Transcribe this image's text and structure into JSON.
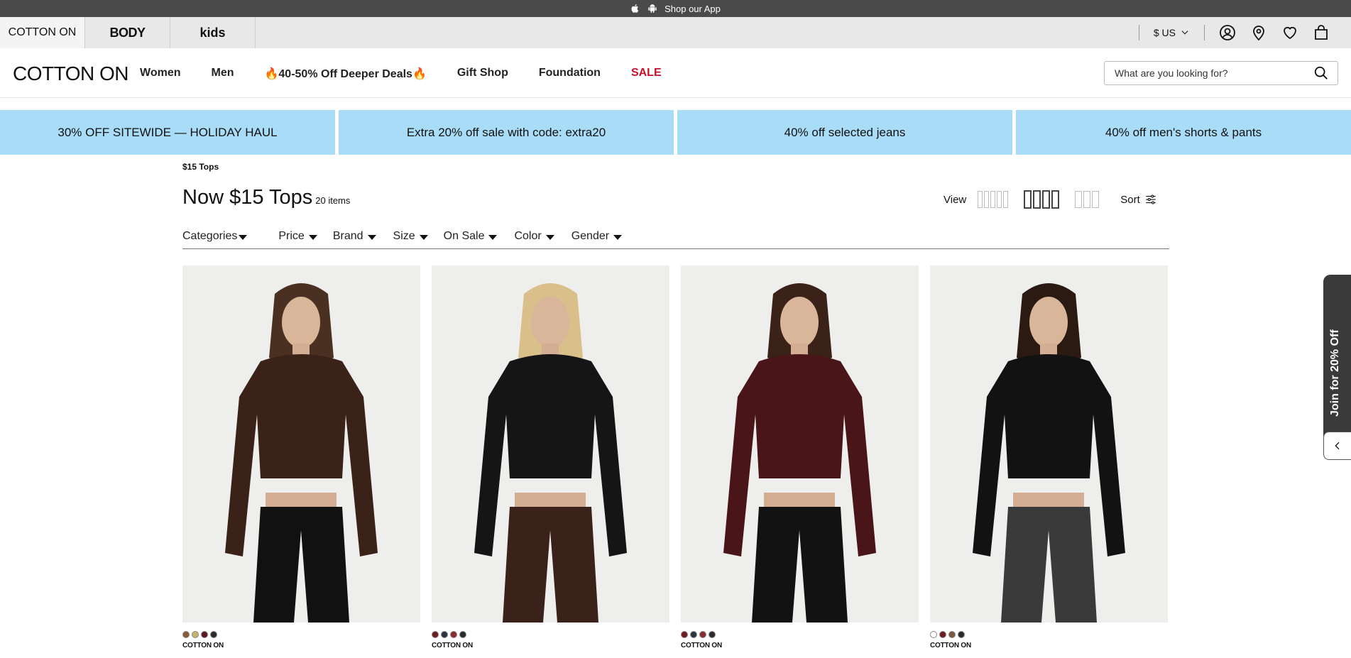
{
  "app_bar": {
    "text": "Shop our App",
    "icons": [
      "apple-icon",
      "android-icon"
    ]
  },
  "brand_tabs": [
    "COTTON ON",
    "BODY",
    "kids"
  ],
  "utility": {
    "currency": "$ US",
    "icons": [
      "account-icon",
      "location-icon",
      "heart-icon",
      "bag-icon"
    ]
  },
  "logo": "COTTON ON",
  "nav": [
    "Women",
    "Men",
    "🔥40-50% Off Deeper Deals🔥",
    "Gift Shop",
    "Foundation",
    "SALE"
  ],
  "search": {
    "placeholder": "What are you looking for?"
  },
  "promos": [
    "30% OFF SITEWIDE — HOLIDAY HAUL",
    "Extra 20% off sale with code: extra20",
    "40% off selected jeans",
    "40% off men's shorts & pants"
  ],
  "breadcrumb": "$15 Tops",
  "page": {
    "title": "Now $15 Tops",
    "count": "20 items"
  },
  "view": {
    "label": "View",
    "selected": "4-column",
    "sort_label": "Sort"
  },
  "filters": [
    "Categories",
    "Price",
    "Brand",
    "Size",
    "On Sale",
    "Color",
    "Gender"
  ],
  "products": [
    {
      "brand": "COTTON ON",
      "top_color": "#3b2218",
      "bottom_color": "#111111",
      "hair": "#4a3020",
      "swatches": [
        "#8a5a34",
        "#c7b46a",
        "#5b1a22",
        "#2b2b2b"
      ]
    },
    {
      "brand": "COTTON ON",
      "top_color": "#151515",
      "bottom_color": "#3a2119",
      "hair": "#d9c08a",
      "swatches": [
        "#6e1d22",
        "#2c3440",
        "#8c2a2e",
        "#2b2b2b"
      ]
    },
    {
      "brand": "COTTON ON",
      "top_color": "#4a1518",
      "bottom_color": "#121212",
      "hair": "#3a2218",
      "swatches": [
        "#6e1d22",
        "#2c3440",
        "#8c2a2e",
        "#2b2b2b"
      ]
    },
    {
      "brand": "COTTON ON",
      "top_color": "#121212",
      "bottom_color": "#3a3a3a",
      "hair": "#2a1a12",
      "swatches": [
        "#ffffff",
        "#6e1d22",
        "#7a5a3a",
        "#2b2b2b"
      ]
    }
  ],
  "join_tab": "Join for 20% Off"
}
